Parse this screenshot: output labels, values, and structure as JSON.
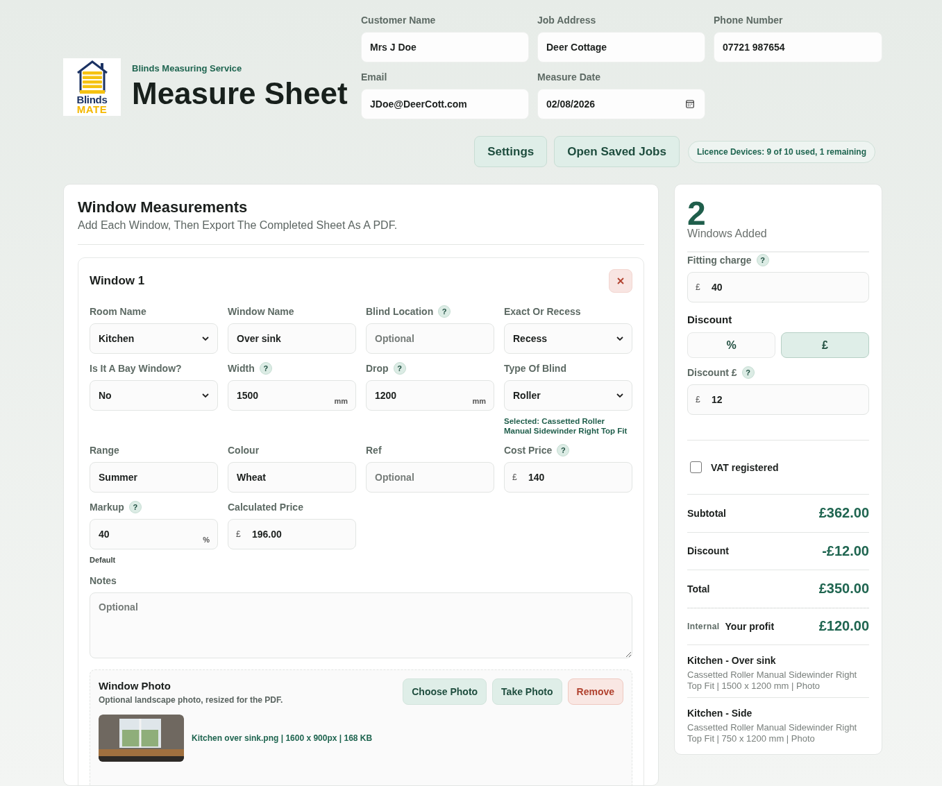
{
  "logo": {
    "line1": "Blinds",
    "line2": "MATE"
  },
  "header": {
    "kicker": "Blinds Measuring Service",
    "title": "Measure Sheet"
  },
  "customer_fields": [
    {
      "label": "Customer Name",
      "kind": "text",
      "value": "Mrs J Doe"
    },
    {
      "label": "Job Address",
      "kind": "text",
      "value": "Deer Cottage"
    },
    {
      "label": "Phone Number",
      "kind": "text",
      "value": "07721 987654"
    },
    {
      "label": "Email",
      "kind": "text",
      "value": "JDoe@DeerCott.com"
    },
    {
      "label": "Measure Date",
      "kind": "date",
      "value": "02/08/2026"
    }
  ],
  "toolbar": {
    "buttons": [
      "Settings",
      "Open Saved Jobs"
    ],
    "licence": "Licence Devices: 9 of 10 used, 1 remaining"
  },
  "measurements": {
    "title": "Window Measurements",
    "subtitle": "Add Each Window, Then Export The Completed Sheet As A PDF.",
    "window": {
      "title": "Window 1",
      "fields": [
        {
          "label": "Room Name",
          "kind": "select",
          "value": "Kitchen"
        },
        {
          "label": "Window Name",
          "kind": "text",
          "value": "Over sink"
        },
        {
          "label": "Blind Location",
          "help": "?",
          "kind": "text",
          "placeholder": "Optional"
        },
        {
          "label": "Exact Or Recess",
          "kind": "select",
          "value": "Recess"
        },
        {
          "label": "Is It A Bay Window?",
          "kind": "select",
          "value": "No"
        },
        {
          "label": "Width",
          "help": "?",
          "kind": "text",
          "value": "1500",
          "unit": "mm"
        },
        {
          "label": "Drop",
          "help": "?",
          "kind": "text",
          "value": "1200",
          "unit": "mm"
        },
        {
          "label": "Type Of Blind",
          "kind": "select",
          "value": "Roller",
          "note": "Selected: Cassetted Roller Manual Sidewinder Right Top Fit"
        },
        {
          "label": "Range",
          "kind": "text",
          "value": "Summer"
        },
        {
          "label": "Colour",
          "kind": "text",
          "value": "Wheat"
        },
        {
          "label": "Ref",
          "kind": "text",
          "placeholder": "Optional"
        },
        {
          "label": "Cost Price",
          "help": "?",
          "kind": "text",
          "prefix": "£",
          "value": "140"
        },
        {
          "label": "Markup",
          "help": "?",
          "kind": "text",
          "value": "40",
          "unit": "%",
          "note": "Default"
        },
        {
          "label": "Calculated Price",
          "kind": "text",
          "prefix": "£",
          "value": "196.00"
        }
      ],
      "notes": {
        "label": "Notes",
        "placeholder": "Optional"
      },
      "photo": {
        "title": "Window Photo",
        "subtitle": "Optional landscape photo, resized for the PDF.",
        "buttons": [
          {
            "label": "Choose Photo",
            "kind": "primary"
          },
          {
            "label": "Take Photo",
            "kind": "primary"
          },
          {
            "label": "Remove",
            "kind": "danger"
          }
        ],
        "file": "Kitchen over sink.png | 1600 x 900px | 168 KB"
      }
    }
  },
  "summary": {
    "count": "2",
    "count_label": "Windows Added",
    "fitting": {
      "label": "Fitting charge",
      "help": "?",
      "kind": "text",
      "prefix": "£",
      "value": "40"
    },
    "discount_title": "Discount",
    "discount_modes": [
      {
        "label": "%",
        "selected": false
      },
      {
        "label": "£",
        "selected": true
      }
    ],
    "discount_field": {
      "label": "Discount £",
      "help": "?",
      "kind": "text",
      "prefix": "£",
      "value": "12"
    },
    "vat": {
      "label": "VAT registered",
      "checked": false
    },
    "totals": [
      {
        "label": "Subtotal",
        "value": "£362.00"
      },
      {
        "label": "Discount",
        "value": "-£12.00"
      },
      {
        "label": "Total",
        "value": "£350.00"
      },
      {
        "label": "Your profit",
        "value": "£120.00",
        "tag": "Internal"
      }
    ],
    "windows": [
      {
        "title": "Kitchen - Over sink",
        "detail": "Cassetted Roller Manual Sidewinder Right Top Fit | 1500 x 1200 mm | Photo"
      },
      {
        "title": "Kitchen - Side",
        "detail": "Cassetted Roller Manual Sidewinder Right Top Fit | 750 x 1200 mm | Photo"
      }
    ]
  }
}
